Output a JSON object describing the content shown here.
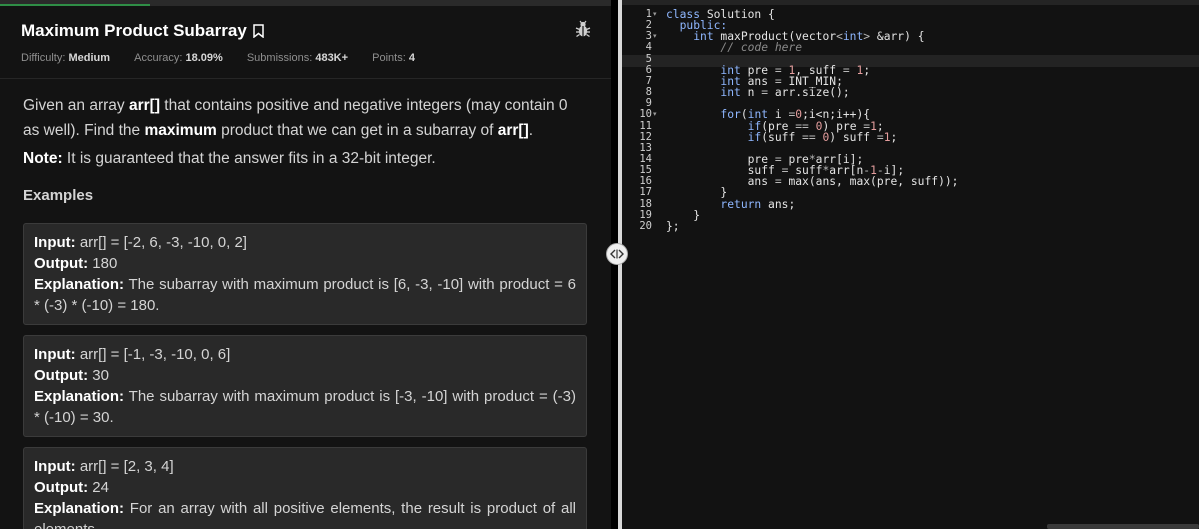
{
  "problem": {
    "title": "Maximum Product Subarray",
    "bookmark_icon": "bookmark-icon",
    "report_icon": "bug-icon",
    "meta": {
      "difficulty_label": "Difficulty:",
      "difficulty": "Medium",
      "accuracy_label": "Accuracy:",
      "accuracy": "18.09%",
      "submissions_label": "Submissions:",
      "submissions": "483K+",
      "points_label": "Points:",
      "points": "4"
    },
    "statement": {
      "t1": "Given an array ",
      "b1": "arr[]",
      "t2": " that contains positive and negative integers (may contain 0 as well). Find the ",
      "b2": "maximum",
      "t3": " product that we can get in a subarray of ",
      "b3": "arr[]",
      "t4": "."
    },
    "note": {
      "label": "Note:",
      "text": " It is guaranteed that the answer fits in a 32-bit integer."
    },
    "examples_heading": "Examples",
    "examples": [
      {
        "input_label": "Input:",
        "input": " arr[] = [-2, 6, -3, -10, 0, 2]",
        "output_label": "Output:",
        "output": " 180",
        "explanation_label": "Explanation:",
        "explanation": " The subarray with maximum product is [6, -3, -10] with product = 6 * (-3) * (-10) = 180."
      },
      {
        "input_label": "Input:",
        "input": " arr[] = [-1, -3, -10, 0, 6]",
        "output_label": "Output:",
        "output": " 30",
        "explanation_label": "Explanation:",
        "explanation": " The subarray with maximum product is [-3, -10] with product = (-3) * (-10) = 30."
      },
      {
        "input_label": "Input:",
        "input": " arr[] = [2, 3, 4]",
        "output_label": "Output:",
        "output": " 24",
        "explanation_label": "Explanation:",
        "explanation": " For an array with all positive elements, the result is product of all elements."
      }
    ]
  },
  "splitter": {
    "handle_icon": "drag-handle-icon"
  },
  "editor": {
    "colors": {
      "keyword": "#8fb7ff",
      "number": "#e59e9e",
      "comment": "#8a8a8a"
    },
    "line_numbers": [
      "1",
      "2",
      "3",
      "4",
      "5",
      "6",
      "7",
      "8",
      "9",
      "10",
      "11",
      "12",
      "13",
      "14",
      "15",
      "16",
      "17",
      "18",
      "19",
      "20"
    ],
    "fold_icon": "fold-arrow-icon",
    "lines": [
      [
        [
          "kw",
          "class"
        ],
        [
          "pl",
          " Solution {"
        ]
      ],
      [
        [
          "kw",
          "  public:"
        ]
      ],
      [
        [
          "pl",
          "    "
        ],
        [
          "kw",
          "int"
        ],
        [
          "pl",
          " maxProduct(vector"
        ],
        [
          "op",
          "<"
        ],
        [
          "kw",
          "int"
        ],
        [
          "op",
          ">"
        ],
        [
          "pl",
          " &arr) {"
        ]
      ],
      [
        [
          "pl",
          "        "
        ],
        [
          "cmt",
          "// code here"
        ]
      ],
      [],
      [
        [
          "pl",
          "        "
        ],
        [
          "kw",
          "int"
        ],
        [
          "pl",
          " pre "
        ],
        [
          "op",
          "="
        ],
        [
          "pl",
          " "
        ],
        [
          "num",
          "1"
        ],
        [
          "pl",
          ", suff "
        ],
        [
          "op",
          "="
        ],
        [
          "pl",
          " "
        ],
        [
          "num",
          "1"
        ],
        [
          "pl",
          ";"
        ]
      ],
      [
        [
          "pl",
          "        "
        ],
        [
          "kw",
          "int"
        ],
        [
          "pl",
          " ans "
        ],
        [
          "op",
          "="
        ],
        [
          "pl",
          " INT_MIN;"
        ]
      ],
      [
        [
          "pl",
          "        "
        ],
        [
          "kw",
          "int"
        ],
        [
          "pl",
          " n "
        ],
        [
          "op",
          "="
        ],
        [
          "pl",
          " arr.size();"
        ]
      ],
      [],
      [
        [
          "pl",
          "        "
        ],
        [
          "kw",
          "for"
        ],
        [
          "pl",
          "("
        ],
        [
          "kw",
          "int"
        ],
        [
          "pl",
          " i "
        ],
        [
          "op",
          "="
        ],
        [
          "num",
          "0"
        ],
        [
          "pl",
          ";i<n;i++){"
        ]
      ],
      [
        [
          "pl",
          "            "
        ],
        [
          "kw",
          "if"
        ],
        [
          "pl",
          "(pre "
        ],
        [
          "op",
          "=="
        ],
        [
          "pl",
          " "
        ],
        [
          "num",
          "0"
        ],
        [
          "pl",
          ") pre "
        ],
        [
          "op",
          "="
        ],
        [
          "num",
          "1"
        ],
        [
          "pl",
          ";"
        ]
      ],
      [
        [
          "pl",
          "            "
        ],
        [
          "kw",
          "if"
        ],
        [
          "pl",
          "(suff "
        ],
        [
          "op",
          "=="
        ],
        [
          "pl",
          " "
        ],
        [
          "num",
          "0"
        ],
        [
          "pl",
          ") suff "
        ],
        [
          "op",
          "="
        ],
        [
          "num",
          "1"
        ],
        [
          "pl",
          ";"
        ]
      ],
      [],
      [
        [
          "pl",
          "            pre "
        ],
        [
          "op",
          "="
        ],
        [
          "pl",
          " pre"
        ],
        [
          "op",
          "*"
        ],
        [
          "pl",
          "arr[i];"
        ]
      ],
      [
        [
          "pl",
          "            suff "
        ],
        [
          "op",
          "="
        ],
        [
          "pl",
          " suff"
        ],
        [
          "op",
          "*"
        ],
        [
          "pl",
          "arr[n"
        ],
        [
          "op",
          "-"
        ],
        [
          "num",
          "1"
        ],
        [
          "op",
          "-"
        ],
        [
          "pl",
          "i];"
        ]
      ],
      [
        [
          "pl",
          "            ans "
        ],
        [
          "op",
          "="
        ],
        [
          "pl",
          " max(ans, max(pre, suff));"
        ]
      ],
      [
        [
          "pl",
          "        }"
        ]
      ],
      [
        [
          "pl",
          "        "
        ],
        [
          "kw",
          "return"
        ],
        [
          "pl",
          " ans;"
        ]
      ],
      [
        [
          "pl",
          "    }"
        ]
      ],
      [
        [
          "pl",
          "};"
        ]
      ]
    ]
  }
}
